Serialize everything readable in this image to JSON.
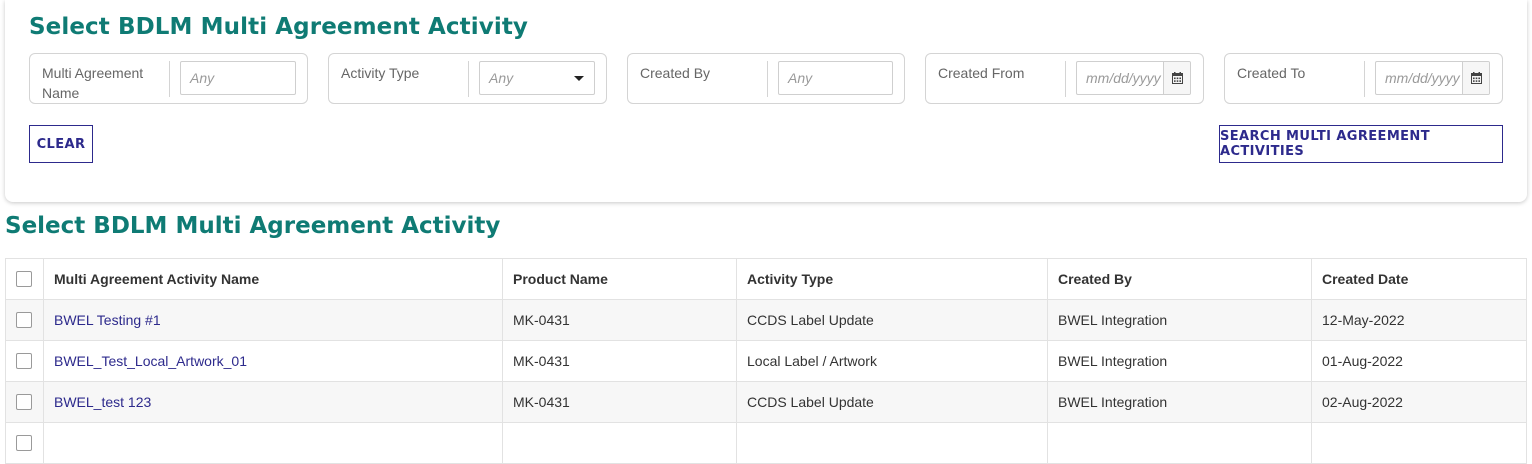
{
  "search": {
    "title": "Select BDLM Multi Agreement Activity",
    "filters": {
      "name": {
        "label": "Multi Agreement Name",
        "placeholder": "Any"
      },
      "activity_type": {
        "label": "Activity Type",
        "selected": "Any"
      },
      "created_by": {
        "label": "Created By",
        "placeholder": "Any"
      },
      "created_from": {
        "label": "Created From",
        "placeholder": "mm/dd/yyyy"
      },
      "created_to": {
        "label": "Created To",
        "placeholder": "mm/dd/yyyy"
      }
    },
    "clear_label": "CLEAR",
    "search_label": "SEARCH MULTI AGREEMENT ACTIVITIES"
  },
  "results": {
    "title": "Select BDLM Multi Agreement Activity",
    "columns": [
      "Multi Agreement Activity Name",
      "Product Name",
      "Activity Type",
      "Created By",
      "Created Date"
    ],
    "rows": [
      {
        "name": "BWEL Testing #1",
        "product": "MK-0431",
        "activity_type": "CCDS Label Update",
        "created_by": "BWEL Integration",
        "created_date": "12-May-2022"
      },
      {
        "name": "BWEL_Test_Local_Artwork_01",
        "product": "MK-0431",
        "activity_type": "Local Label / Artwork",
        "created_by": "BWEL Integration",
        "created_date": "01-Aug-2022"
      },
      {
        "name": "BWEL_test 123",
        "product": "MK-0431",
        "activity_type": "CCDS Label Update",
        "created_by": "BWEL Integration",
        "created_date": "02-Aug-2022"
      }
    ]
  },
  "colors": {
    "title": "#0f7b74",
    "accent": "#2d2a8c",
    "border": "#d4d4d4"
  },
  "icons": [
    "caret-down-icon",
    "calendar-icon",
    "checkbox-icon"
  ]
}
